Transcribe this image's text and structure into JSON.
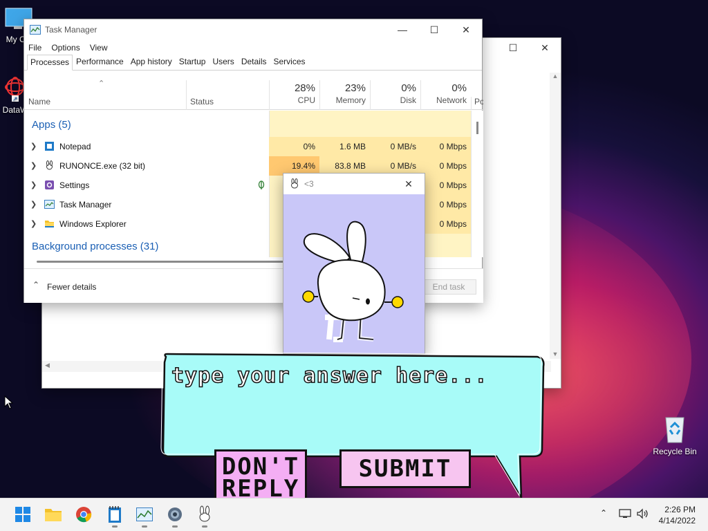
{
  "desktop": {
    "icons": [
      {
        "label": "My Co",
        "icon": "computer-icon"
      },
      {
        "label": "DataW",
        "icon": "datawrapper-icon"
      },
      {
        "label": "Recycle Bin",
        "icon": "recycle-bin-icon"
      }
    ]
  },
  "task_manager": {
    "title": "Task Manager",
    "menu": [
      "File",
      "Options",
      "View"
    ],
    "tabs": [
      "Processes",
      "Performance",
      "App history",
      "Startup",
      "Users",
      "Details",
      "Services"
    ],
    "active_tab": "Processes",
    "columns": {
      "name": "Name",
      "status": "Status",
      "cpu": {
        "pct": "28%",
        "label": "CPU"
      },
      "memory": {
        "pct": "23%",
        "label": "Memory"
      },
      "disk": {
        "pct": "0%",
        "label": "Disk"
      },
      "network": {
        "pct": "0%",
        "label": "Network"
      },
      "power": "Po"
    },
    "groups": {
      "apps": "Apps (5)",
      "background": "Background processes (31)"
    },
    "apps": [
      {
        "name": "Notepad",
        "icon": "notepad-icon",
        "cpu": "0%",
        "memory": "1.6 MB",
        "disk": "0 MB/s",
        "network": "0 Mbps"
      },
      {
        "name": "RUNONCE.exe (32 bit)",
        "icon": "bunny-icon",
        "cpu": "19.4%",
        "memory": "83.8 MB",
        "disk": "0 MB/s",
        "network": "0 Mbps"
      },
      {
        "name": "Settings",
        "icon": "settings-icon",
        "cpu": "",
        "memory": "",
        "disk": "",
        "network": "0 Mbps"
      },
      {
        "name": "Task Manager",
        "icon": "task-manager-icon",
        "cpu": "",
        "memory": "",
        "disk": "",
        "network": "0 Mbps"
      },
      {
        "name": "Windows Explorer",
        "icon": "folder-icon",
        "cpu": "",
        "memory": "",
        "disk": "",
        "network": "0 Mbps"
      }
    ],
    "fewer_details": "Fewer details",
    "end_task": "End task"
  },
  "bunny_window": {
    "title": "<3"
  },
  "dialog": {
    "placeholder": "type your answer here...",
    "dont_reply": "DON'T REPLY",
    "submit": "SUBMIT"
  },
  "taskbar": {
    "apps": [
      "start-icon",
      "file-explorer-icon",
      "chrome-icon",
      "notepad-icon",
      "task-manager-icon",
      "settings-icon",
      "bunny-icon"
    ],
    "time": "2:26 PM",
    "date": "4/14/2022"
  },
  "colors": {
    "bubble_fill": "#a8fbf8",
    "bunny_bg": "#c9c7f8",
    "button_pink": "#f4aef4",
    "accent_blue": "#1a5fb4"
  }
}
